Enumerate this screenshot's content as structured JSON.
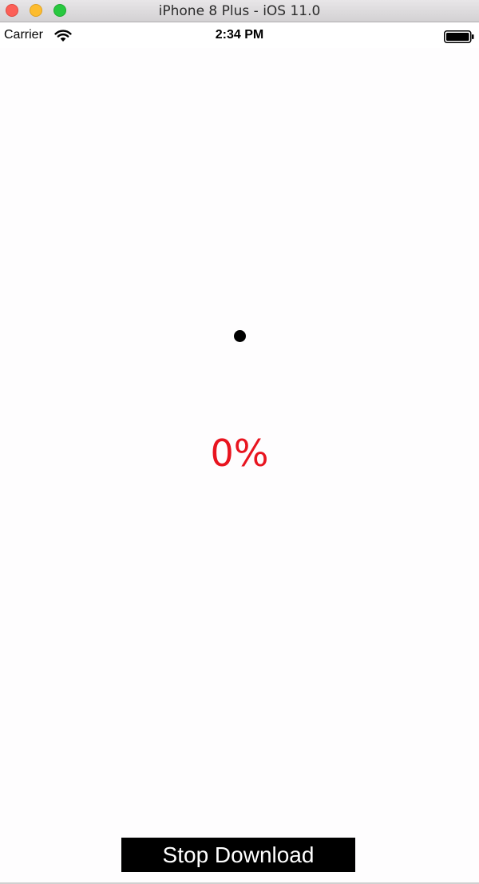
{
  "window": {
    "title": "iPhone 8 Plus - iOS 11.0"
  },
  "status_bar": {
    "carrier": "Carrier",
    "time": "2:34 PM"
  },
  "main": {
    "progress_percent": 0,
    "progress_text": "0%",
    "stop_button_label": "Stop Download"
  },
  "icons": {
    "wifi": "wifi-icon",
    "battery": "battery-icon"
  },
  "colors": {
    "percent_text": "#e8141f",
    "button_background": "#000000",
    "button_text": "#ffffff"
  }
}
